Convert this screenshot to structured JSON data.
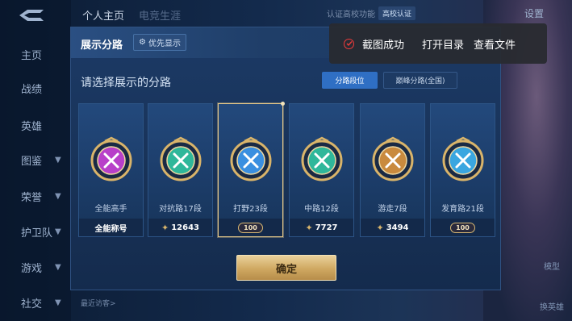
{
  "sidebar": {
    "items": [
      {
        "label": "主页",
        "chevron": false
      },
      {
        "label": "战绩",
        "chevron": false
      },
      {
        "label": "英雄",
        "chevron": false
      },
      {
        "label": "图鉴",
        "chevron": true
      },
      {
        "label": "荣誉",
        "chevron": true
      },
      {
        "label": "护卫队",
        "chevron": true
      },
      {
        "label": "游戏",
        "chevron": true
      },
      {
        "label": "社交",
        "chevron": true
      }
    ]
  },
  "topbar": {
    "tab_profile": "个人主页",
    "tab_other": "电竞生涯",
    "cert_text": "认证高校功能",
    "cert_badge": "高校认证",
    "settings": "设置"
  },
  "modal": {
    "title": "展示分路",
    "priority_button": "优先显示",
    "subtitle": "请选择展示的分路",
    "segment_on": "分路段位",
    "segment_off": "巅峰分路(全国)",
    "confirm": "确定",
    "cards": [
      {
        "label": "全能高手",
        "foot": "全能称号",
        "foot_type": "text",
        "color": "#b83fc9"
      },
      {
        "label": "对抗路17段",
        "foot": "12643",
        "foot_type": "score",
        "color": "#2fb79a"
      },
      {
        "label": "打野23段",
        "foot": "100",
        "foot_type": "pill",
        "color": "#3a8fe0",
        "selected": true
      },
      {
        "label": "中路12段",
        "foot": "7727",
        "foot_type": "score",
        "color": "#2fb79a"
      },
      {
        "label": "游走7段",
        "foot": "3494",
        "foot_type": "score",
        "color": "#c98a3e"
      },
      {
        "label": "发育路21段",
        "foot": "100",
        "foot_type": "pill",
        "color": "#3aa6e0"
      }
    ]
  },
  "toast": {
    "message": "截图成功",
    "action_open": "打开目录",
    "action_view": "查看文件"
  },
  "bottom": {
    "visitors": "最近访客>"
  },
  "right_labels": {
    "model": "模型",
    "switch_hero": "换英雄"
  }
}
